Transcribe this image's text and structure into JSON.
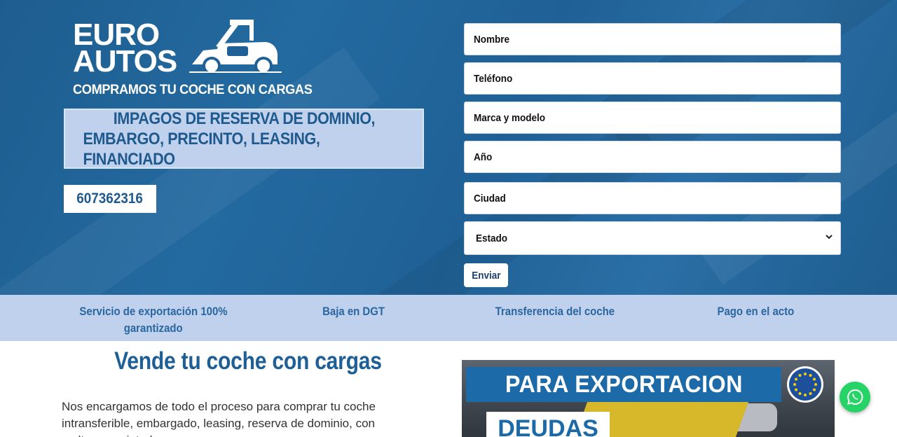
{
  "logo": {
    "line1": "EURO",
    "line2": "AUTOS"
  },
  "tagline": "COMPRAMOS TU COCHE CON CARGAS",
  "debt_box": {
    "line1": "IMPAGOS DE RESERVA DE DOMINIO,",
    "line2": "EMBARGO, PRECINTO, LEASING, FINANCIADO"
  },
  "phone": "607362316",
  "form": {
    "nombre": "Nombre",
    "telefono": "Teléfono",
    "marca_modelo": "Marca y modelo",
    "anio": "Año",
    "ciudad": "Ciudad",
    "estado": "Estado",
    "submit": "Enviar"
  },
  "features": {
    "f1_line1": "Servicio de exportación 100%",
    "f1_line2": "garantizado",
    "f2": "Baja en DGT",
    "f3": "Transferencia del coche",
    "f4": "Pago en el acto"
  },
  "main": {
    "headline": "Vende tu coche con cargas",
    "paragraph": "Nos encargamos de todo el proceso para comprar tu coche intransferible, embargado, leasing, reserva de dominio, con multas, precintado..."
  },
  "promo": {
    "banner": "PARA EXPORTACION",
    "sub": "DEUDAS"
  },
  "colors": {
    "hero_blue": "#1f6196",
    "light_blue": "#bfd1ec",
    "text_blue": "#1f5a8e",
    "whatsapp_green": "#25d366"
  },
  "icons": [
    "tow-truck-icon",
    "chevron-down-icon",
    "eu-flag-icon",
    "whatsapp-icon"
  ]
}
